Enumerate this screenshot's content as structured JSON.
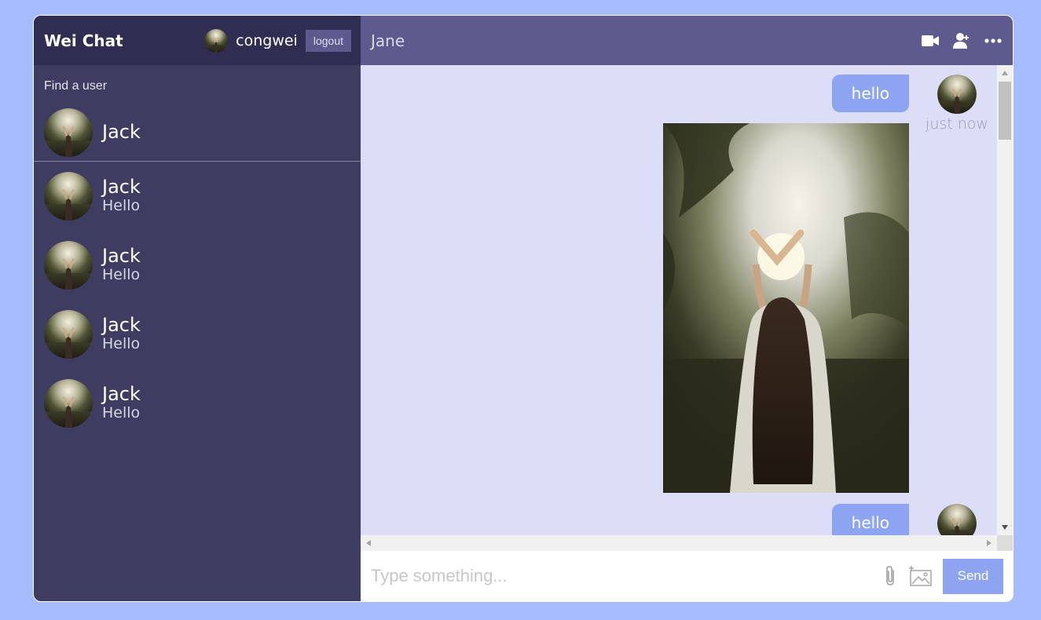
{
  "sidebar": {
    "logo": "Wei Chat",
    "current_user": {
      "name": "congwei",
      "logout_label": "logout"
    },
    "search": {
      "placeholder": "Find a user",
      "result": {
        "name": "Jack"
      }
    },
    "chats": [
      {
        "name": "Jack",
        "last_message": "Hello"
      },
      {
        "name": "Jack",
        "last_message": "Hello"
      },
      {
        "name": "Jack",
        "last_message": "Hello"
      },
      {
        "name": "Jack",
        "last_message": "Hello"
      }
    ]
  },
  "chat": {
    "title": "Jane",
    "icons": [
      "video-camera-icon",
      "add-user-icon",
      "more-icon"
    ],
    "messages": [
      {
        "text": "hello",
        "time": "just now",
        "has_image": true
      },
      {
        "text": "hello",
        "time": "",
        "has_image": false
      }
    ],
    "input": {
      "placeholder": "Type something...",
      "send_label": "Send"
    }
  },
  "colors": {
    "background": "#a7bcff",
    "sidebar": "#3e3c61",
    "navbar": "#2f2d52",
    "chat_header": "#5d5b8d",
    "chat_body": "#ddddf7",
    "bubble": "#8da4f1"
  }
}
